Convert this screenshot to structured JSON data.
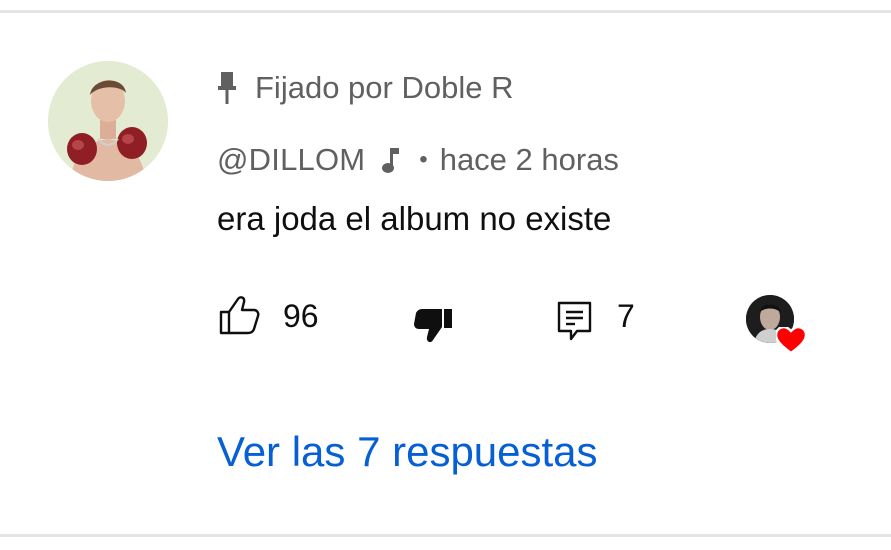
{
  "comment": {
    "pinned_label": "Fijado por Doble R",
    "author": "@DILLOM",
    "separator": "•",
    "time": "hace 2 horas",
    "text": "era joda el album no existe",
    "likes": "96",
    "replies_count": "7",
    "view_replies_label": "Ver las 7 respuestas"
  },
  "icons": {
    "pin": "pin-icon",
    "music": "music-note-icon",
    "like": "thumbs-up-icon",
    "dislike": "thumbs-down-icon",
    "reply": "reply-icon",
    "heart": "heart-icon"
  },
  "colors": {
    "secondary_text": "#606060",
    "primary_text": "#0f0f0f",
    "link": "#065fd4",
    "heart": "#ff0000",
    "divider": "#e4e4e4"
  }
}
